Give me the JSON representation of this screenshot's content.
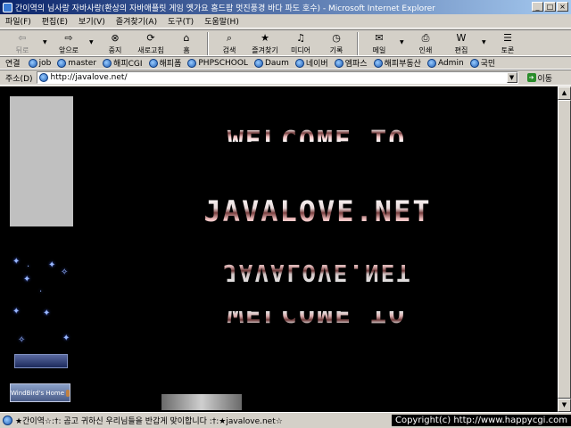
{
  "window": {
    "title": "간이역의 님사랑 자바사랑(환상의 자바애플릿 게임 옛가요 홈드팝 멋진풍경 바다 파도 호수) - Microsoft Internet Explorer",
    "min_label": "_",
    "max_label": "□",
    "close_label": "×"
  },
  "menu": [
    "파일(F)",
    "편집(E)",
    "보기(V)",
    "즐겨찾기(A)",
    "도구(T)",
    "도움말(H)"
  ],
  "toolbar": {
    "back": "뒤로",
    "forward": "앞으로",
    "stop": "중지",
    "refresh": "새로고침",
    "home": "홈",
    "search": "검색",
    "favorites": "즐겨찾기",
    "media": "미디어",
    "history": "기록",
    "mail": "메일",
    "print": "인쇄",
    "edit": "편집",
    "discuss": "토론"
  },
  "links": {
    "label": "연결",
    "items": [
      "job",
      "master",
      "해피CGI",
      "해피폼",
      "PHPSCHOOL",
      "Daum",
      "네이버",
      "엠파스",
      "해피부동산",
      "Admin",
      "국민"
    ]
  },
  "address": {
    "label": "주소(D)",
    "url": "http://javalove.net/",
    "go": "이동"
  },
  "page": {
    "welcome_top": "WELCOME TO",
    "main_title": "JAVALOVE.NET",
    "mirror_title": "JAVALOVE.NET",
    "welcome_bottom": "WELCOME TO",
    "windbird": "WindBird's Home"
  },
  "status": {
    "text": "★간이역☆:†: 곰고 귀하신 우리님들을 반갑게 맞이합니다 :†:★javalove.net☆",
    "copyright": "Copyright(c) http://www.happycgi.com"
  }
}
